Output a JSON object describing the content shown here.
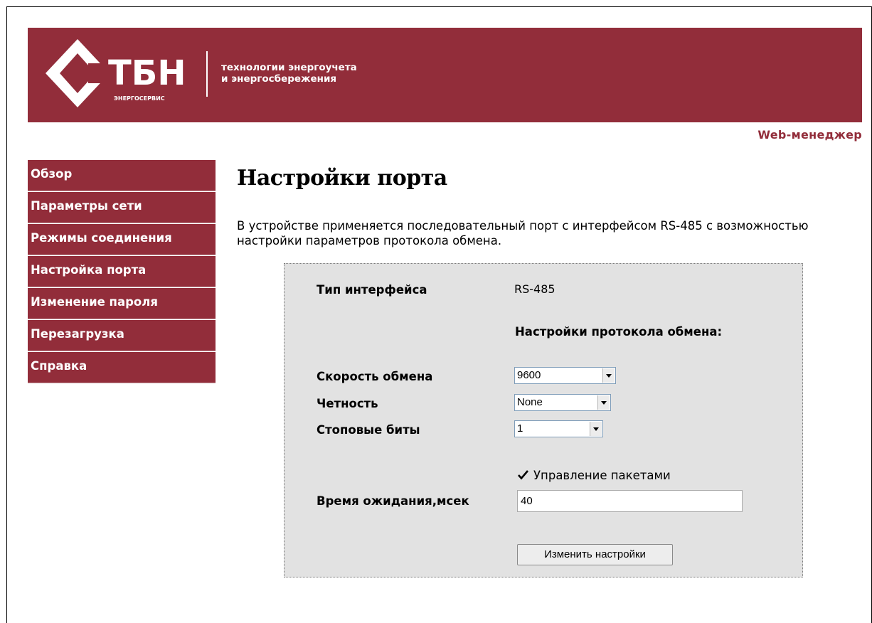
{
  "header": {
    "logo_text": "ТБН",
    "logo_subtext": "ЭНЕРГОСЕРВИС",
    "tagline_line1": "технологии энергоучета",
    "tagline_line2": "и энергосбережения",
    "web_manager": "Web-менеджер"
  },
  "colors": {
    "brand": "#922d3a",
    "panel_bg": "#e2e2e2"
  },
  "sidebar": {
    "items": [
      {
        "label": "Обзор"
      },
      {
        "label": "Параметры сети"
      },
      {
        "label": "Режимы соединения"
      },
      {
        "label": "Настройка порта"
      },
      {
        "label": "Изменение пароля"
      },
      {
        "label": "Перезагрузка"
      },
      {
        "label": "Справка"
      }
    ]
  },
  "main": {
    "title": "Настройки порта",
    "intro": "В устройстве применяется последовательный порт с интерфейсом RS-485 с возможностью настройки параметров протокола обмена."
  },
  "form": {
    "interface_type_label": "Тип интерфейса",
    "interface_type_value": "RS-485",
    "protocol_heading": "Настройки протокола обмена:",
    "baud_label": "Скорость обмена",
    "baud_value": "9600",
    "parity_label": "Четность",
    "parity_value": "None",
    "stopbits_label": "Стоповые биты",
    "stopbits_value": "1",
    "packet_control_label": "Управление пакетами",
    "packet_control_checked": true,
    "timeout_label": "Время ожидания,мсек",
    "timeout_value": "40",
    "submit_label": "Изменить настройки"
  }
}
